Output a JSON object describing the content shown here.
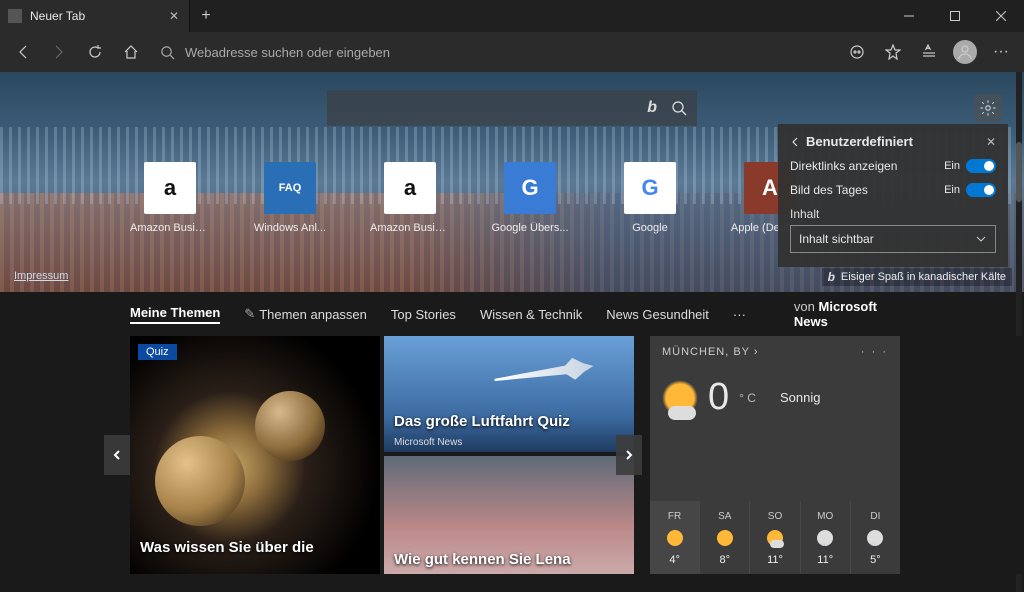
{
  "titlebar": {
    "tab_title": "Neuer Tab"
  },
  "toolbar": {
    "address_placeholder": "Webadresse suchen oder eingeben"
  },
  "tiles": [
    {
      "label": "Amazon Busin...",
      "glyph": "a",
      "bg": "#ffffff",
      "fg": "#111"
    },
    {
      "label": "Windows Anl...",
      "glyph": "FAQ",
      "bg": "#2a6fb5",
      "fg": "#fff"
    },
    {
      "label": "Amazon Busin...",
      "glyph": "a",
      "bg": "#ffffff",
      "fg": "#111"
    },
    {
      "label": "Google Übers...",
      "glyph": "G",
      "bg": "#3a7bd5",
      "fg": "#fff"
    },
    {
      "label": "Google",
      "glyph": "G",
      "bg": "#ffffff",
      "fg": "#4285F4"
    },
    {
      "label": "Apple (Deutsc...",
      "glyph": "A",
      "bg": "#8a3a2a",
      "fg": "#fff"
    }
  ],
  "hero": {
    "impressum": "Impressum",
    "credit": "Eisiger Spaß in kanadischer Kälte"
  },
  "panel": {
    "title": "Benutzerdefiniert",
    "row1_label": "Direktlinks anzeigen",
    "row2_label": "Bild des Tages",
    "on_text": "Ein",
    "content_label": "Inhalt",
    "select_value": "Inhalt sichtbar"
  },
  "newsnav": {
    "items": [
      "Meine Themen",
      "Themen anpassen",
      "Top Stories",
      "Wissen & Technik",
      "News Gesundheit"
    ],
    "by_prefix": "von",
    "by_brand": "Microsoft News"
  },
  "cards": {
    "quiz_badge": "Quiz",
    "a_title": "Was wissen Sie über die",
    "b_title": "Das große Luftfahrt Quiz",
    "b_sub": "Microsoft News",
    "c_title": "Wie gut kennen Sie Lena"
  },
  "weather": {
    "location": "MÜNCHEN, BY",
    "temp": "0",
    "unit": "° C",
    "condition": "Sonnig",
    "days": [
      {
        "name": "FR",
        "icon": "sun",
        "temp": "4°"
      },
      {
        "name": "SA",
        "icon": "sun",
        "temp": "8°"
      },
      {
        "name": "SO",
        "icon": "partly",
        "temp": "11°"
      },
      {
        "name": "MO",
        "icon": "rain",
        "temp": "11°"
      },
      {
        "name": "DI",
        "icon": "rain",
        "temp": "5°"
      }
    ]
  }
}
